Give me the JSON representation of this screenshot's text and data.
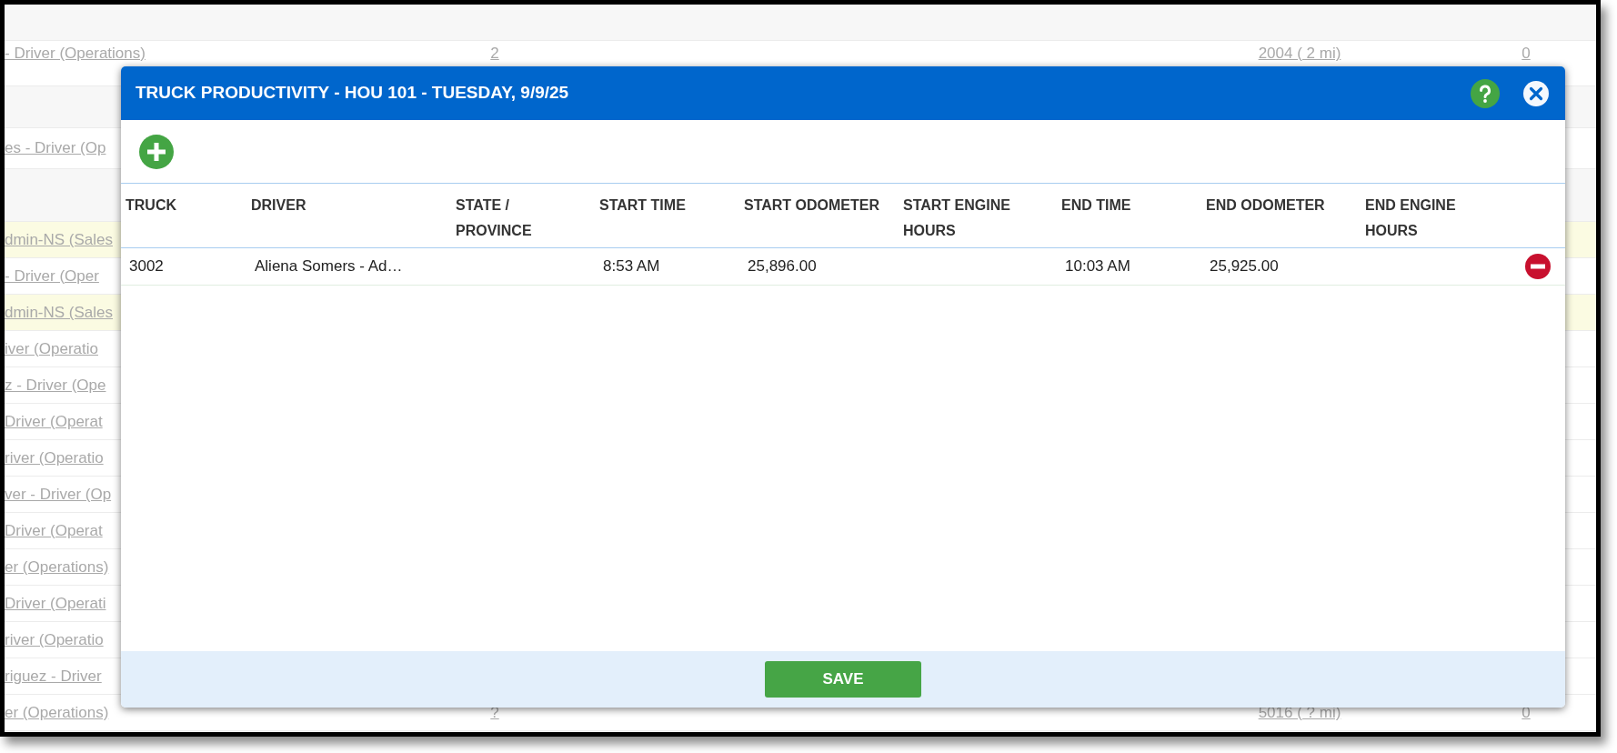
{
  "background": {
    "rows": [
      {
        "kind": "band"
      },
      {
        "kind": "row",
        "highlighted": false,
        "driver": "- Driver (Operations)",
        "column_2": "2",
        "column_3": "2004 ( 2 mi)",
        "column_4": "0"
      },
      {
        "kind": "band"
      },
      {
        "kind": "row",
        "highlighted": false,
        "driver": "es - Driver (Op"
      },
      {
        "kind": "band"
      },
      {
        "kind": "row",
        "highlighted": true,
        "driver": "dmin-NS (Sales"
      },
      {
        "kind": "row",
        "highlighted": false,
        "driver": "- Driver (Oper"
      },
      {
        "kind": "row",
        "highlighted": true,
        "driver": "dmin-NS (Sales"
      },
      {
        "kind": "row",
        "highlighted": false,
        "driver": "iver (Operatio"
      },
      {
        "kind": "row",
        "highlighted": false,
        "driver": "z - Driver (Ope"
      },
      {
        "kind": "row",
        "highlighted": false,
        "driver": "Driver (Operat"
      },
      {
        "kind": "row",
        "highlighted": false,
        "driver": "river (Operatio"
      },
      {
        "kind": "row",
        "highlighted": false,
        "driver": "ver - Driver (Op"
      },
      {
        "kind": "row",
        "highlighted": false,
        "driver": "Driver (Operat"
      },
      {
        "kind": "row",
        "highlighted": false,
        "driver": "er (Operations)"
      },
      {
        "kind": "row",
        "highlighted": false,
        "driver": "Driver (Operati"
      },
      {
        "kind": "row",
        "highlighted": false,
        "driver": "river (Operatio"
      },
      {
        "kind": "row",
        "highlighted": false,
        "driver": "riguez - Driver"
      },
      {
        "kind": "row",
        "highlighted": false,
        "driver": "er (Operations)",
        "column_2": "?",
        "column_3": "5016 ( ? mi)",
        "column_4": "0"
      }
    ]
  },
  "dialog": {
    "title": "TRUCK PRODUCTIVITY - HOU 101 - TUESDAY, 9/9/25",
    "table": {
      "columns": [
        "TRUCK",
        "DRIVER",
        "STATE / PROVINCE",
        "START TIME",
        "START ODOMETER",
        "START ENGINE HOURS",
        "END TIME",
        "END ODOMETER",
        "END ENGINE HOURS"
      ],
      "rows": [
        {
          "cells": [
            "3002",
            "Aliena Somers - Ad…",
            "",
            "8:53 AM",
            "25,896.00",
            "",
            "10:03 AM",
            "25,925.00",
            ""
          ]
        }
      ]
    },
    "save_button": "SAVE"
  }
}
